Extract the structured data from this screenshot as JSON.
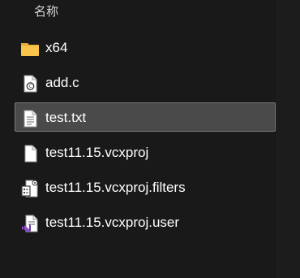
{
  "header": {
    "name_column": "名称"
  },
  "files": [
    {
      "name": "x64",
      "icon": "folder-icon",
      "selected": false
    },
    {
      "name": "add.c",
      "icon": "c-source-file-icon",
      "selected": false
    },
    {
      "name": "test.txt",
      "icon": "text-file-icon",
      "selected": true
    },
    {
      "name": "test11.15.vcxproj",
      "icon": "blank-file-icon",
      "selected": false
    },
    {
      "name": "test11.15.vcxproj.filters",
      "icon": "filters-file-icon",
      "selected": false
    },
    {
      "name": "test11.15.vcxproj.user",
      "icon": "vs-user-file-icon",
      "selected": false
    }
  ],
  "colors": {
    "background": "#191919",
    "selection_bg": "#4a4a4a",
    "selection_border": "#7a7a7a",
    "folder": "#f8c44a",
    "vs_purple": "#8c4fcf"
  }
}
